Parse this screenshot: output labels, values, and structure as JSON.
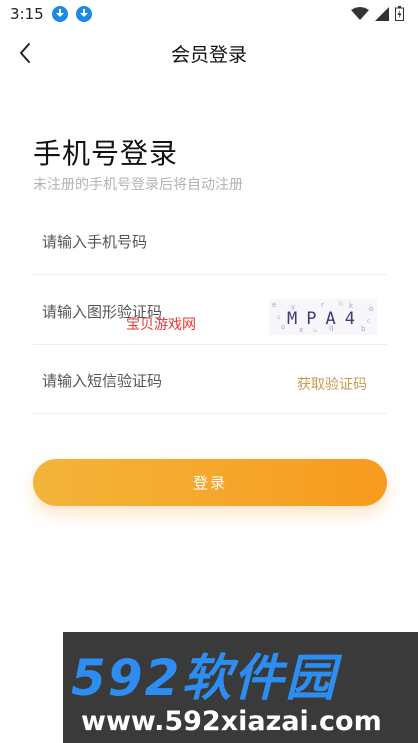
{
  "status_bar": {
    "time": "3:15",
    "icons": [
      "download-icon",
      "download-icon",
      "wifi-icon",
      "signal-icon",
      "battery-icon"
    ]
  },
  "header": {
    "title": "会员登录",
    "back_icon": "chevron-left-icon"
  },
  "login": {
    "heading": "手机号登录",
    "subheading": "未注册的手机号登录后将自动注册",
    "phone_placeholder": "请输入手机号码",
    "captcha_placeholder": "请输入图形验证码",
    "captcha_code": "MPA4",
    "sms_placeholder": "请输入短信验证码",
    "sms_button": "获取验证码",
    "submit_button": "登录"
  },
  "watermarks": {
    "overlay_text": "宝贝游戏网",
    "banner_main": "592软件园",
    "banner_sub": "www.592xiazai.com"
  },
  "colors": {
    "accent_gradient_start": "#f3b43a",
    "accent_gradient_end": "#f79b1e",
    "sms_link": "#c89a4e",
    "download_icon": "#1e88e5",
    "banner_blue": "#2e8df0"
  }
}
